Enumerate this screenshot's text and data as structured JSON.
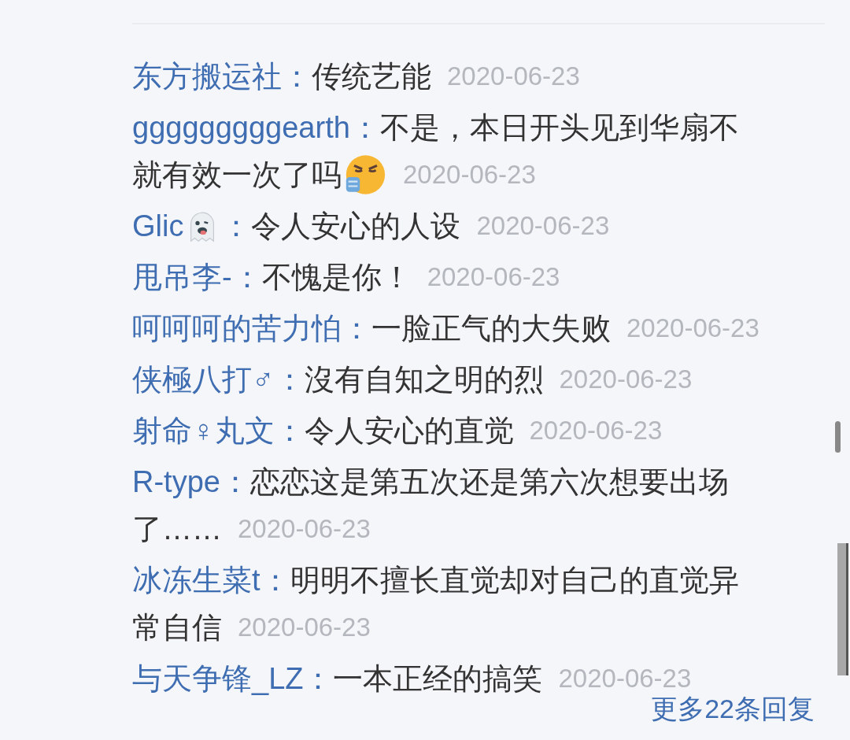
{
  "comments": [
    {
      "user": "东方搬运社：",
      "text_lines": [
        "传统艺能"
      ],
      "date": "2020-06-23"
    },
    {
      "user": "gggggggggearth：",
      "text_lines": [
        "不是，本日开头见到华扇不",
        "就有效一次了吗"
      ],
      "text_icon": true,
      "date": "2020-06-23"
    },
    {
      "user": "Glic",
      "user_icon": true,
      "colon": "：",
      "text_lines": [
        "令人安心的人设"
      ],
      "date": "2020-06-23"
    },
    {
      "user": "甩吊李-：",
      "text_lines": [
        "不愧是你！"
      ],
      "date": "2020-06-23"
    },
    {
      "user": "呵呵呵的苦力怕：",
      "text_lines": [
        "一脸正气的大失败"
      ],
      "date": "2020-06-23"
    },
    {
      "user": "侠極八打♂：",
      "text_lines": [
        "沒有自知之明的烈"
      ],
      "date": "2020-06-23"
    },
    {
      "user": "射命♀丸文：",
      "text_lines": [
        "令人安心的直觉"
      ],
      "date": "2020-06-23"
    },
    {
      "user": "R-type：",
      "text_lines": [
        "恋恋这是第五次还是第六次想要出场",
        "了……"
      ],
      "date": "2020-06-23"
    },
    {
      "user": "冰冻生菜t：",
      "text_lines": [
        "明明不擅长直觉却对自己的直觉异",
        "常自信"
      ],
      "date": "2020-06-23"
    },
    {
      "user": "与天争锋_LZ：",
      "text_lines": [
        "一本正经的搞笑"
      ],
      "date": "2020-06-23"
    }
  ],
  "more_link": "更多22条回复"
}
